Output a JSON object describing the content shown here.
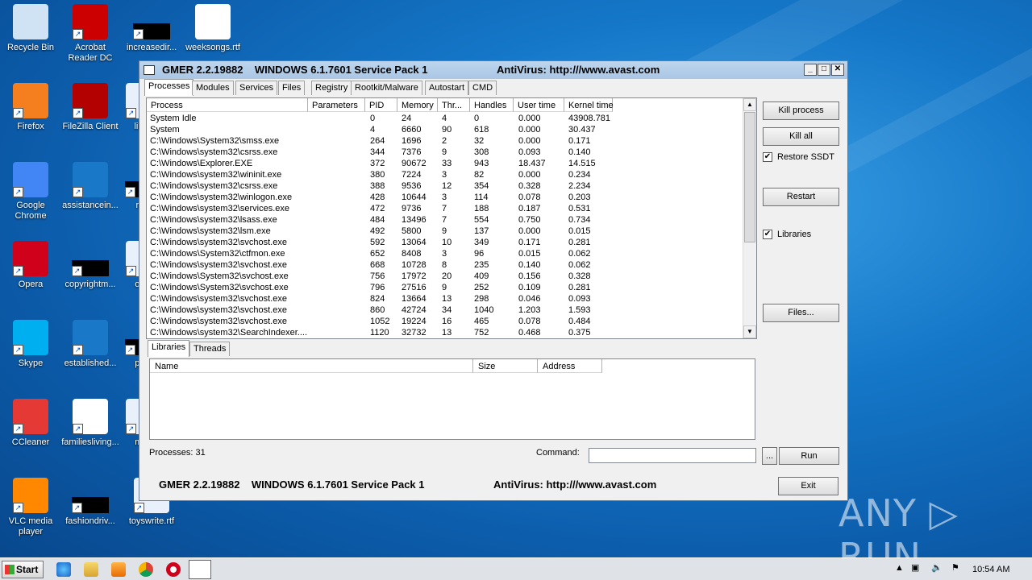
{
  "desktop": {
    "icons": [
      {
        "label": "Recycle Bin"
      },
      {
        "label": "Acrobat Reader DC"
      },
      {
        "label": "increasedir..."
      },
      {
        "label": "weeksongs.rtf"
      },
      {
        "label": "Firefox"
      },
      {
        "label": "FileZilla Client"
      },
      {
        "label": "linktr"
      },
      {
        "label": "Google Chrome"
      },
      {
        "label": "assistancein..."
      },
      {
        "label": "mar"
      },
      {
        "label": "Opera"
      },
      {
        "label": "copyrightm..."
      },
      {
        "label": "othe"
      },
      {
        "label": "Skype"
      },
      {
        "label": "established..."
      },
      {
        "label": "prov"
      },
      {
        "label": "CCleaner"
      },
      {
        "label": "familiesliving..."
      },
      {
        "label": "mod"
      },
      {
        "label": "VLC media player"
      },
      {
        "label": "fashiondriv..."
      },
      {
        "label": "toyswrite.rtf"
      }
    ],
    "watermark": "ANY ▷ RUN"
  },
  "window": {
    "title_left": "GMER 2.2.19882    WINDOWS 6.1.7601 Service Pack 1",
    "title_right": "AntiVirus: http:///www.avast.com",
    "tabs": [
      "Processes",
      "Modules",
      "Services",
      "Files",
      "Registry",
      "Rootkit/Malware",
      "Autostart",
      "CMD"
    ],
    "process_columns": [
      "Process",
      "Parameters",
      "PID",
      "Memory",
      "Thr...",
      "Handles",
      "User time",
      "Kernel time"
    ],
    "processes": [
      {
        "name": "System Idle",
        "params": "",
        "pid": "0",
        "memory": "24",
        "threads": "4",
        "handles": "0",
        "user": "0.000",
        "kernel": "43908.781"
      },
      {
        "name": "System",
        "params": "",
        "pid": "4",
        "memory": "6660",
        "threads": "90",
        "handles": "618",
        "user": "0.000",
        "kernel": "30.437"
      },
      {
        "name": "C:\\Windows\\System32\\smss.exe",
        "params": "",
        "pid": "264",
        "memory": "1696",
        "threads": "2",
        "handles": "32",
        "user": "0.000",
        "kernel": "0.171"
      },
      {
        "name": "C:\\Windows\\system32\\csrss.exe",
        "params": "",
        "pid": "344",
        "memory": "7376",
        "threads": "9",
        "handles": "308",
        "user": "0.093",
        "kernel": "0.140"
      },
      {
        "name": "C:\\Windows\\Explorer.EXE",
        "params": "",
        "pid": "372",
        "memory": "90672",
        "threads": "33",
        "handles": "943",
        "user": "18.437",
        "kernel": "14.515"
      },
      {
        "name": "C:\\Windows\\system32\\wininit.exe",
        "params": "",
        "pid": "380",
        "memory": "7224",
        "threads": "3",
        "handles": "82",
        "user": "0.000",
        "kernel": "0.234"
      },
      {
        "name": "C:\\Windows\\system32\\csrss.exe",
        "params": "",
        "pid": "388",
        "memory": "9536",
        "threads": "12",
        "handles": "354",
        "user": "0.328",
        "kernel": "2.234"
      },
      {
        "name": "C:\\Windows\\system32\\winlogon.exe",
        "params": "",
        "pid": "428",
        "memory": "10644",
        "threads": "3",
        "handles": "114",
        "user": "0.078",
        "kernel": "0.203"
      },
      {
        "name": "C:\\Windows\\system32\\services.exe",
        "params": "",
        "pid": "472",
        "memory": "9736",
        "threads": "7",
        "handles": "188",
        "user": "0.187",
        "kernel": "0.531"
      },
      {
        "name": "C:\\Windows\\system32\\lsass.exe",
        "params": "",
        "pid": "484",
        "memory": "13496",
        "threads": "7",
        "handles": "554",
        "user": "0.750",
        "kernel": "0.734"
      },
      {
        "name": "C:\\Windows\\system32\\lsm.exe",
        "params": "",
        "pid": "492",
        "memory": "5800",
        "threads": "9",
        "handles": "137",
        "user": "0.000",
        "kernel": "0.015"
      },
      {
        "name": "C:\\Windows\\system32\\svchost.exe",
        "params": "",
        "pid": "592",
        "memory": "13064",
        "threads": "10",
        "handles": "349",
        "user": "0.171",
        "kernel": "0.281"
      },
      {
        "name": "C:\\Windows\\System32\\ctfmon.exe",
        "params": "",
        "pid": "652",
        "memory": "8408",
        "threads": "3",
        "handles": "96",
        "user": "0.015",
        "kernel": "0.062"
      },
      {
        "name": "C:\\Windows\\system32\\svchost.exe",
        "params": "",
        "pid": "668",
        "memory": "10728",
        "threads": "8",
        "handles": "235",
        "user": "0.140",
        "kernel": "0.062"
      },
      {
        "name": "C:\\Windows\\System32\\svchost.exe",
        "params": "",
        "pid": "756",
        "memory": "17972",
        "threads": "20",
        "handles": "409",
        "user": "0.156",
        "kernel": "0.328"
      },
      {
        "name": "C:\\Windows\\System32\\svchost.exe",
        "params": "",
        "pid": "796",
        "memory": "27516",
        "threads": "9",
        "handles": "252",
        "user": "0.109",
        "kernel": "0.281"
      },
      {
        "name": "C:\\Windows\\system32\\svchost.exe",
        "params": "",
        "pid": "824",
        "memory": "13664",
        "threads": "13",
        "handles": "298",
        "user": "0.046",
        "kernel": "0.093"
      },
      {
        "name": "C:\\Windows\\system32\\svchost.exe",
        "params": "",
        "pid": "860",
        "memory": "42724",
        "threads": "34",
        "handles": "1040",
        "user": "1.203",
        "kernel": "1.593"
      },
      {
        "name": "C:\\Windows\\system32\\svchost.exe",
        "params": "",
        "pid": "1052",
        "memory": "19224",
        "threads": "16",
        "handles": "465",
        "user": "0.078",
        "kernel": "0.484"
      },
      {
        "name": "C:\\Windows\\system32\\SearchIndexer....",
        "params": "",
        "pid": "1120",
        "memory": "32732",
        "threads": "13",
        "handles": "752",
        "user": "0.468",
        "kernel": "0.375"
      }
    ],
    "subtabs": [
      "Libraries",
      "Threads"
    ],
    "lib_columns": [
      "Name",
      "Size",
      "Address"
    ],
    "buttons": {
      "kill_process": "Kill process",
      "kill_all": "Kill all",
      "restart": "Restart",
      "files": "Files...",
      "browse": "...",
      "run": "Run",
      "exit": "Exit"
    },
    "checks": {
      "restore_ssdt": {
        "label": "Restore SSDT",
        "checked": true
      },
      "libraries": {
        "label": "Libraries",
        "checked": true
      }
    },
    "processes_count": "Processes: 31",
    "command_label": "Command:",
    "command_value": "",
    "footer_left": "GMER 2.2.19882    WINDOWS 6.1.7601 Service Pack 1",
    "footer_right": "AntiVirus: http:///www.avast.com"
  },
  "taskbar": {
    "start": "Start",
    "clock": "10:54 AM"
  }
}
